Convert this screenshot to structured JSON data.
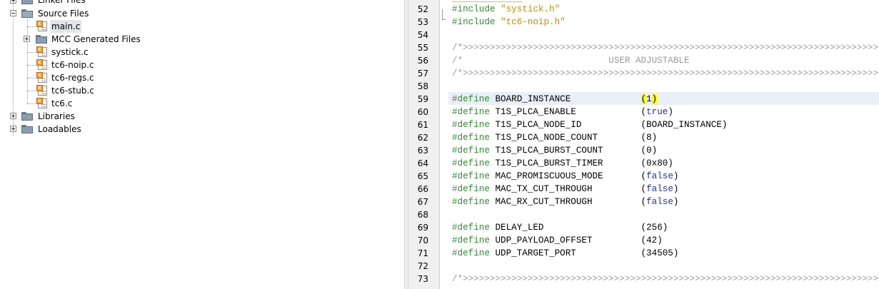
{
  "project_tree": {
    "linker_files": "Linker Files",
    "source_files": "Source Files",
    "files": [
      {
        "label": "main.c",
        "selected": true
      },
      {
        "label": "MCC Generated Files",
        "folder": true
      },
      {
        "label": "systick.c"
      },
      {
        "label": "tc6-noip.c"
      },
      {
        "label": "tc6-regs.c"
      },
      {
        "label": "tc6-stub.c"
      },
      {
        "label": "tc6.c"
      }
    ],
    "libraries": "Libraries",
    "loadables": "Loadables"
  },
  "editor": {
    "lines": [
      {
        "num": "52",
        "parts": [
          [
            "kw",
            "#include "
          ],
          [
            "str",
            "\"systick.h\""
          ]
        ]
      },
      {
        "num": "53",
        "parts": [
          [
            "kw",
            "#include "
          ],
          [
            "str",
            "\"tc6-noip.h\""
          ]
        ]
      },
      {
        "num": "54",
        "parts": []
      },
      {
        "num": "55",
        "parts": [
          [
            "cm",
            "/*>>>>>>>>>>>>>>>>>>>>>>>>>>>>>>>>>>>>>>>>>>>>>>>>>>>>>>>>>>>>>>>>>>>>>>>>>>>>>>>*/"
          ]
        ]
      },
      {
        "num": "56",
        "parts": [
          [
            "cm",
            "/*                           USER ADJUSTABLE                                       */"
          ]
        ]
      },
      {
        "num": "57",
        "parts": [
          [
            "cm",
            "/*>>>>>>>>>>>>>>>>>>>>>>>>>>>>>>>>>>>>>>>>>>>>>>>>>>>>>>>>>>>>>>>>>>>>>>>>>>>>>>>*/"
          ]
        ]
      },
      {
        "num": "58",
        "parts": []
      },
      {
        "num": "59",
        "parts": [
          [
            "kw",
            "#define "
          ],
          [
            "",
            "BOARD_INSTANCE             "
          ],
          [
            "hl",
            "("
          ],
          [
            "",
            "1"
          ],
          [
            "hl",
            ")"
          ]
        ]
      },
      {
        "num": "60",
        "parts": [
          [
            "kw",
            "#define "
          ],
          [
            "",
            "T1S_PLCA_ENABLE            ("
          ],
          [
            "bool",
            "true"
          ],
          [
            "",
            ")"
          ]
        ]
      },
      {
        "num": "61",
        "parts": [
          [
            "kw",
            "#define "
          ],
          [
            "",
            "T1S_PLCA_NODE_ID           (BOARD_INSTANCE)"
          ]
        ]
      },
      {
        "num": "62",
        "parts": [
          [
            "kw",
            "#define "
          ],
          [
            "",
            "T1S_PLCA_NODE_COUNT        (8)"
          ]
        ]
      },
      {
        "num": "63",
        "parts": [
          [
            "kw",
            "#define "
          ],
          [
            "",
            "T1S_PLCA_BURST_COUNT       (0)"
          ]
        ]
      },
      {
        "num": "64",
        "parts": [
          [
            "kw",
            "#define "
          ],
          [
            "",
            "T1S_PLCA_BURST_TIMER       (0x80)"
          ]
        ]
      },
      {
        "num": "65",
        "parts": [
          [
            "kw",
            "#define "
          ],
          [
            "",
            "MAC_PROMISCUOUS_MODE       ("
          ],
          [
            "bool",
            "false"
          ],
          [
            "",
            ")"
          ]
        ]
      },
      {
        "num": "66",
        "parts": [
          [
            "kw",
            "#define "
          ],
          [
            "",
            "MAC_TX_CUT_THROUGH         ("
          ],
          [
            "bool",
            "false"
          ],
          [
            "",
            ")"
          ]
        ]
      },
      {
        "num": "67",
        "parts": [
          [
            "kw",
            "#define "
          ],
          [
            "",
            "MAC_RX_CUT_THROUGH         ("
          ],
          [
            "bool",
            "false"
          ],
          [
            "",
            ")"
          ]
        ]
      },
      {
        "num": "68",
        "parts": []
      },
      {
        "num": "69",
        "parts": [
          [
            "kw",
            "#define "
          ],
          [
            "",
            "DELAY_LED                  (256)"
          ]
        ]
      },
      {
        "num": "70",
        "parts": [
          [
            "kw",
            "#define "
          ],
          [
            "",
            "UDP_PAYLOAD_OFFSET         (42)"
          ]
        ]
      },
      {
        "num": "71",
        "parts": [
          [
            "kw",
            "#define "
          ],
          [
            "",
            "UDP_TARGET_PORT            (34505)"
          ]
        ]
      },
      {
        "num": "72",
        "parts": []
      },
      {
        "num": "73",
        "parts": [
          [
            "cm",
            "/*>>>>>>>>>>>>>>>>>>>>>>>>>>>>>>>>>>>>>>>>>>>>>>>>>>>>>>>>>>>>>>>>>>>>>>>>>>>>>>>*/"
          ]
        ]
      }
    ],
    "current_line": "59"
  },
  "colors": {
    "keyword": "#2f8a2f",
    "string": "#c88a00",
    "comment": "#9a9a9a",
    "boolean": "#1f2f9f",
    "bracket_highlight": "#ffff00",
    "current_line_bg": "#e9eff8"
  }
}
